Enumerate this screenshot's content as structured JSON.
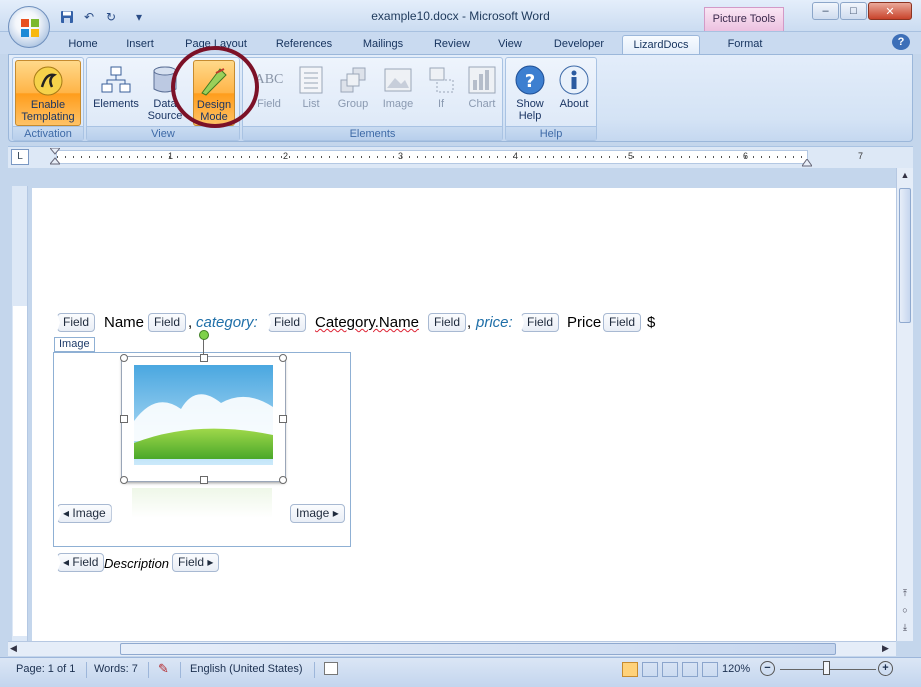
{
  "window": {
    "title": "example10.docx - Microsoft Word",
    "contextual_tab": "Picture Tools",
    "minimize": "–",
    "maximize": "□",
    "close": "✕"
  },
  "quick_access": {
    "save": "save-icon",
    "undo": "↶",
    "redo": "↻",
    "customize": "▾"
  },
  "tabs": [
    "Home",
    "Insert",
    "Page Layout",
    "References",
    "Mailings",
    "Review",
    "View",
    "Developer",
    "LizardDocs",
    "Format"
  ],
  "active_tab": "LizardDocs",
  "help_glyph": "?",
  "ribbon": {
    "groups": [
      {
        "label": "Activation",
        "buttons": [
          {
            "line1": "Enable",
            "line2": "Templating"
          }
        ]
      },
      {
        "label": "View",
        "buttons": [
          {
            "line1": "Elements",
            "line2": ""
          },
          {
            "line1": "Data",
            "line2": "Source"
          },
          {
            "line1": "Design",
            "line2": "Mode"
          }
        ]
      },
      {
        "label": "Elements",
        "buttons": [
          {
            "line1": "Field"
          },
          {
            "line1": "List"
          },
          {
            "line1": "Group"
          },
          {
            "line1": "Image"
          },
          {
            "line1": "If"
          },
          {
            "line1": "Chart"
          }
        ]
      },
      {
        "label": "Help",
        "buttons": [
          {
            "line1": "Show",
            "line2": "Help"
          },
          {
            "line1": "About",
            "line2": ""
          }
        ]
      }
    ],
    "abc_glyph": "ABC"
  },
  "ruler": {
    "numbers": [
      "1",
      "2",
      "3",
      "4",
      "5",
      "6",
      "7"
    ],
    "corner": "L"
  },
  "document": {
    "line1": {
      "field_tag": "Field",
      "name": "Name",
      "sep1": ",",
      "category_label": "category:",
      "category_value": "Category.Name",
      "sep2": ",",
      "price_label": "price:",
      "price_value": "Price",
      "currency": "$"
    },
    "image_control_label": "Image",
    "image_tag": "Image",
    "description": "Description"
  },
  "status": {
    "page": "Page: 1 of 1",
    "words": "Words: 7",
    "language": "English (United States)",
    "zoom": "120%",
    "zoom_minus": "−",
    "zoom_plus": "+"
  }
}
